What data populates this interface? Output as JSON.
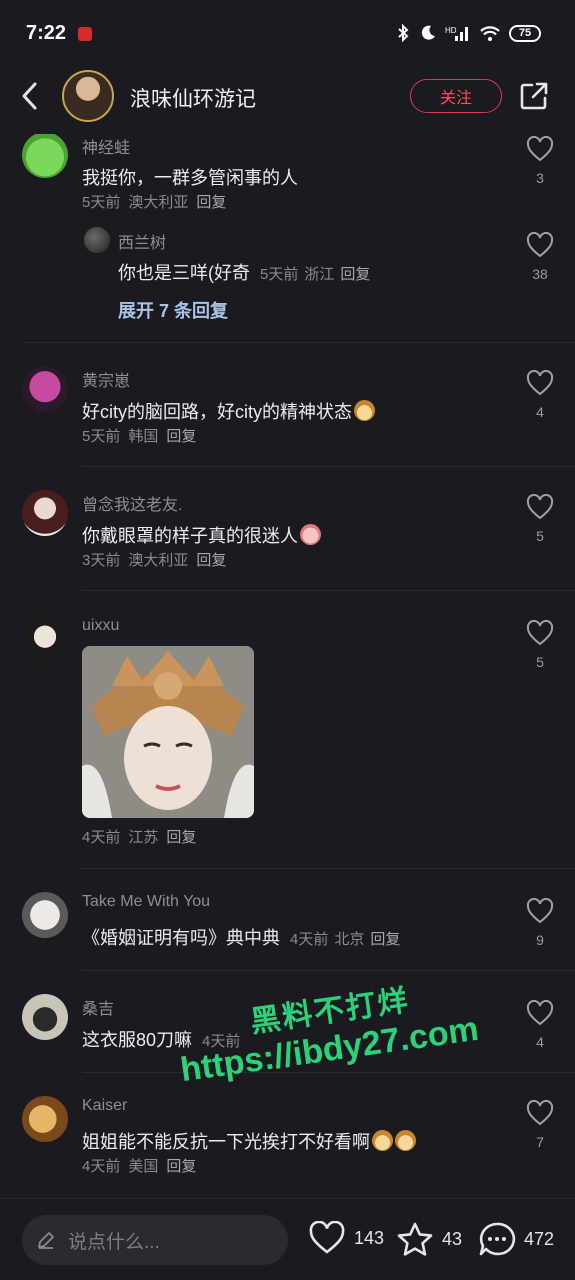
{
  "status_bar": {
    "time": "7:22",
    "battery": "75"
  },
  "header": {
    "title": "浪味仙环游记",
    "follow_label": "关注"
  },
  "comments": [
    {
      "username": "神经蛙",
      "text": "我挺你，一群多管闲事的人",
      "time": "5天前",
      "location": "澳大利亚",
      "reply_label": "回复",
      "likes": "3",
      "sub_reply": {
        "username": "西兰树",
        "text": "你也是三咩(好奇",
        "time": "5天前",
        "location": "浙江",
        "reply_label": "回复",
        "likes": "38"
      },
      "expand_label": "展开 7 条回复"
    },
    {
      "username": "黄宗崽",
      "text": "好city的脑回路，好city的精神状态",
      "emoji": "dog-emoji",
      "time": "5天前",
      "location": "韩国",
      "reply_label": "回复",
      "likes": "4"
    },
    {
      "username": "曾念我这老友.",
      "text": "你戴眼罩的样子真的很迷人",
      "emoji": "peach-emoji",
      "time": "3天前",
      "location": "澳大利亚",
      "reply_label": "回复",
      "likes": "5"
    },
    {
      "username": "uixxu",
      "image": "bodhisattva-statue-photo",
      "time": "4天前",
      "location": "江苏",
      "reply_label": "回复",
      "likes": "5"
    },
    {
      "username": "Take Me With You",
      "text": "《婚姻证明有吗》典中典",
      "time": "4天前",
      "location": "北京",
      "reply_label": "回复",
      "likes": "9"
    },
    {
      "username": "桑吉",
      "text": "这衣服80刀嘛",
      "time": "4天前",
      "likes": "4"
    },
    {
      "username": "Kaiser",
      "text": "姐姐能不能反抗一下光挨打不好看啊",
      "emoji": "dog-emoji",
      "time": "4天前",
      "location": "美国",
      "reply_label": "回复",
      "likes": "7"
    }
  ],
  "watermark": {
    "line1": "黑料不打烊",
    "line2": "https://ibdy27.com"
  },
  "bottom_bar": {
    "input_placeholder": "说点什么...",
    "likes": "143",
    "stars": "43",
    "comments": "472"
  },
  "colors": {
    "background": "#1a1a20",
    "accent": "#ff4a5c",
    "link": "#a9c3e6",
    "watermark": "#2fd07a"
  }
}
